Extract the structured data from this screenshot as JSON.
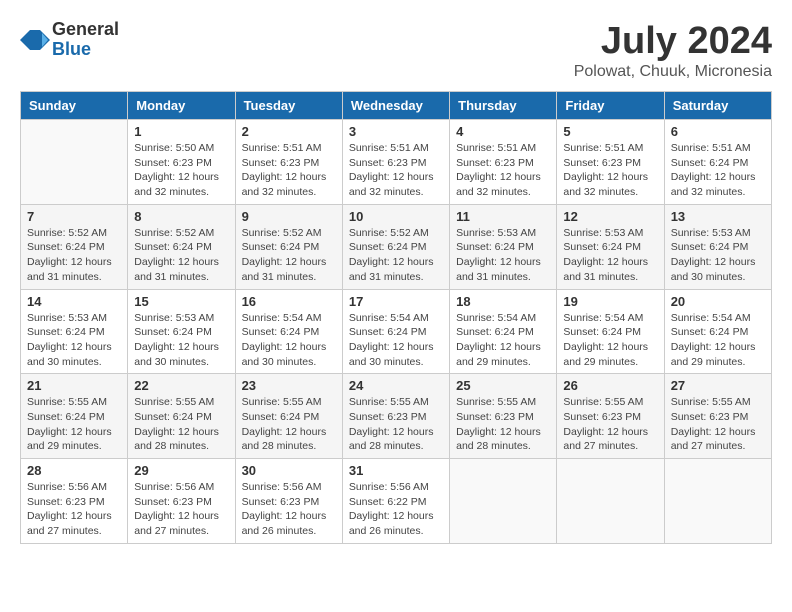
{
  "header": {
    "logo_general": "General",
    "logo_blue": "Blue",
    "title": "July 2024",
    "location": "Polowat, Chuuk, Micronesia"
  },
  "days_of_week": [
    "Sunday",
    "Monday",
    "Tuesday",
    "Wednesday",
    "Thursday",
    "Friday",
    "Saturday"
  ],
  "weeks": [
    [
      {
        "day": "",
        "info": ""
      },
      {
        "day": "1",
        "info": "Sunrise: 5:50 AM\nSunset: 6:23 PM\nDaylight: 12 hours\nand 32 minutes."
      },
      {
        "day": "2",
        "info": "Sunrise: 5:51 AM\nSunset: 6:23 PM\nDaylight: 12 hours\nand 32 minutes."
      },
      {
        "day": "3",
        "info": "Sunrise: 5:51 AM\nSunset: 6:23 PM\nDaylight: 12 hours\nand 32 minutes."
      },
      {
        "day": "4",
        "info": "Sunrise: 5:51 AM\nSunset: 6:23 PM\nDaylight: 12 hours\nand 32 minutes."
      },
      {
        "day": "5",
        "info": "Sunrise: 5:51 AM\nSunset: 6:23 PM\nDaylight: 12 hours\nand 32 minutes."
      },
      {
        "day": "6",
        "info": "Sunrise: 5:51 AM\nSunset: 6:24 PM\nDaylight: 12 hours\nand 32 minutes."
      }
    ],
    [
      {
        "day": "7",
        "info": "Sunrise: 5:52 AM\nSunset: 6:24 PM\nDaylight: 12 hours\nand 31 minutes."
      },
      {
        "day": "8",
        "info": "Sunrise: 5:52 AM\nSunset: 6:24 PM\nDaylight: 12 hours\nand 31 minutes."
      },
      {
        "day": "9",
        "info": "Sunrise: 5:52 AM\nSunset: 6:24 PM\nDaylight: 12 hours\nand 31 minutes."
      },
      {
        "day": "10",
        "info": "Sunrise: 5:52 AM\nSunset: 6:24 PM\nDaylight: 12 hours\nand 31 minutes."
      },
      {
        "day": "11",
        "info": "Sunrise: 5:53 AM\nSunset: 6:24 PM\nDaylight: 12 hours\nand 31 minutes."
      },
      {
        "day": "12",
        "info": "Sunrise: 5:53 AM\nSunset: 6:24 PM\nDaylight: 12 hours\nand 31 minutes."
      },
      {
        "day": "13",
        "info": "Sunrise: 5:53 AM\nSunset: 6:24 PM\nDaylight: 12 hours\nand 30 minutes."
      }
    ],
    [
      {
        "day": "14",
        "info": "Sunrise: 5:53 AM\nSunset: 6:24 PM\nDaylight: 12 hours\nand 30 minutes."
      },
      {
        "day": "15",
        "info": "Sunrise: 5:53 AM\nSunset: 6:24 PM\nDaylight: 12 hours\nand 30 minutes."
      },
      {
        "day": "16",
        "info": "Sunrise: 5:54 AM\nSunset: 6:24 PM\nDaylight: 12 hours\nand 30 minutes."
      },
      {
        "day": "17",
        "info": "Sunrise: 5:54 AM\nSunset: 6:24 PM\nDaylight: 12 hours\nand 30 minutes."
      },
      {
        "day": "18",
        "info": "Sunrise: 5:54 AM\nSunset: 6:24 PM\nDaylight: 12 hours\nand 29 minutes."
      },
      {
        "day": "19",
        "info": "Sunrise: 5:54 AM\nSunset: 6:24 PM\nDaylight: 12 hours\nand 29 minutes."
      },
      {
        "day": "20",
        "info": "Sunrise: 5:54 AM\nSunset: 6:24 PM\nDaylight: 12 hours\nand 29 minutes."
      }
    ],
    [
      {
        "day": "21",
        "info": "Sunrise: 5:55 AM\nSunset: 6:24 PM\nDaylight: 12 hours\nand 29 minutes."
      },
      {
        "day": "22",
        "info": "Sunrise: 5:55 AM\nSunset: 6:24 PM\nDaylight: 12 hours\nand 28 minutes."
      },
      {
        "day": "23",
        "info": "Sunrise: 5:55 AM\nSunset: 6:24 PM\nDaylight: 12 hours\nand 28 minutes."
      },
      {
        "day": "24",
        "info": "Sunrise: 5:55 AM\nSunset: 6:23 PM\nDaylight: 12 hours\nand 28 minutes."
      },
      {
        "day": "25",
        "info": "Sunrise: 5:55 AM\nSunset: 6:23 PM\nDaylight: 12 hours\nand 28 minutes."
      },
      {
        "day": "26",
        "info": "Sunrise: 5:55 AM\nSunset: 6:23 PM\nDaylight: 12 hours\nand 27 minutes."
      },
      {
        "day": "27",
        "info": "Sunrise: 5:55 AM\nSunset: 6:23 PM\nDaylight: 12 hours\nand 27 minutes."
      }
    ],
    [
      {
        "day": "28",
        "info": "Sunrise: 5:56 AM\nSunset: 6:23 PM\nDaylight: 12 hours\nand 27 minutes."
      },
      {
        "day": "29",
        "info": "Sunrise: 5:56 AM\nSunset: 6:23 PM\nDaylight: 12 hours\nand 27 minutes."
      },
      {
        "day": "30",
        "info": "Sunrise: 5:56 AM\nSunset: 6:23 PM\nDaylight: 12 hours\nand 26 minutes."
      },
      {
        "day": "31",
        "info": "Sunrise: 5:56 AM\nSunset: 6:22 PM\nDaylight: 12 hours\nand 26 minutes."
      },
      {
        "day": "",
        "info": ""
      },
      {
        "day": "",
        "info": ""
      },
      {
        "day": "",
        "info": ""
      }
    ]
  ]
}
